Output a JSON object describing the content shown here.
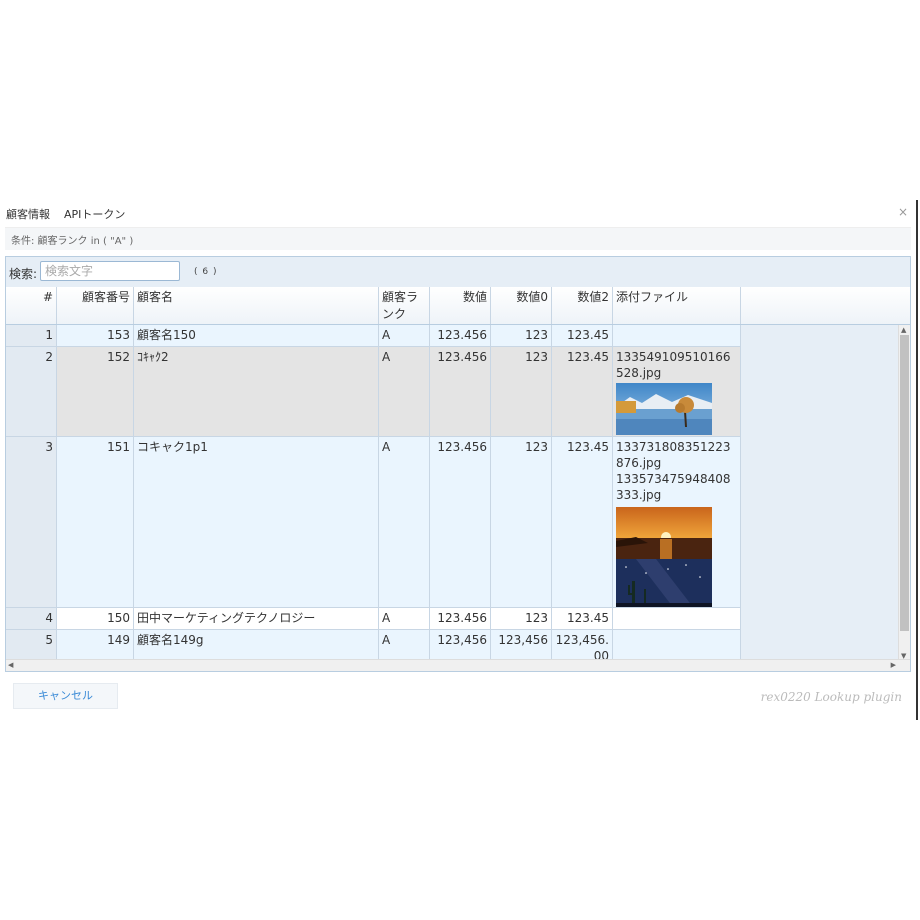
{
  "dialog": {
    "title_app": "顧客情報",
    "title_token": "APIトークン",
    "close_label": "×",
    "condition": "条件: 顧客ランク in ( \"A\" )"
  },
  "search": {
    "label": "検索:",
    "placeholder": "検索文字",
    "value": "",
    "count": "( 6 )"
  },
  "table": {
    "headers": {
      "index": "#",
      "customer_no": "顧客番号",
      "customer_name": "顧客名",
      "rank": "顧客ランク",
      "num": "数値",
      "num0": "数値0",
      "num2": "数値2",
      "attachment": "添付ファイル"
    },
    "rows": [
      {
        "index": "1",
        "customer_no": "153",
        "customer_name": "顧客名150",
        "rank": "A",
        "num": "123.456",
        "num0": "123",
        "num2": "123.45",
        "files": []
      },
      {
        "index": "2",
        "customer_no": "152",
        "customer_name": "ｺｷｬｸ2",
        "rank": "A",
        "num": "123.456",
        "num0": "123",
        "num2": "123.45",
        "files": [
          "133549109510166528.jpg"
        ]
      },
      {
        "index": "3",
        "customer_no": "151",
        "customer_name": "コキャク1p1",
        "rank": "A",
        "num": "123.456",
        "num0": "123",
        "num2": "123.45",
        "files": [
          "133731808351223876.jpg",
          "133573475948408333.jpg"
        ]
      },
      {
        "index": "4",
        "customer_no": "150",
        "customer_name": "田中マーケティングテクノロジー",
        "rank": "A",
        "num": "123.456",
        "num0": "123",
        "num2": "123.45",
        "files": []
      },
      {
        "index": "5",
        "customer_no": "149",
        "customer_name": "顧客名149g",
        "rank": "A",
        "num": "123,456",
        "num0": "123,456",
        "num2": "123,456.00",
        "files": []
      }
    ]
  },
  "footer": {
    "cancel_label": "キャンセル",
    "brand": "rex0220 Lookup plugin"
  },
  "icons": {
    "thumbnail_1": "lake-tree-photo-icon",
    "thumbnail_2": "sunset-sea-photo-icon",
    "thumbnail_3": "night-sky-cactus-photo-icon"
  }
}
